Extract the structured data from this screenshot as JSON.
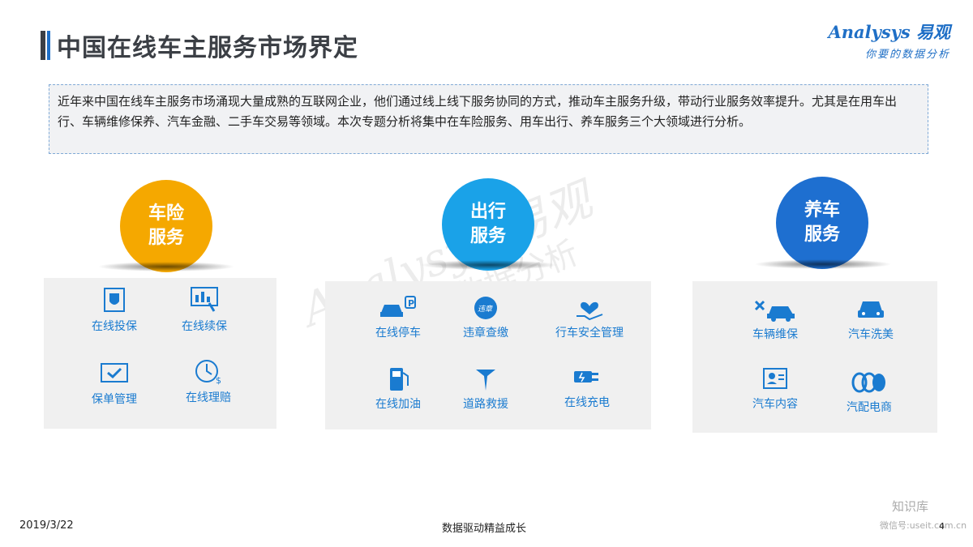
{
  "header": {
    "title": "中国在线车主服务市场界定",
    "logo_brand": "Analysys 易观",
    "logo_slogan": "你要的数据分析"
  },
  "intro": "近年来中国在线车主服务市场涌现大量成熟的互联网企业，他们通过线上线下服务协同的方式，推动车主服务升级，带动行业服务效率提升。尤其是在用车出行、车辆维修保养、汽车金融、二手车交易等领域。本次专题分析将集中在车险服务、用车出行、养车服务三个大领域进行分析。",
  "sections": [
    {
      "name_line1": "车险",
      "name_line2": "服务",
      "color": "#f5a800",
      "items": [
        "在线投保",
        "在线续保",
        "保单管理",
        "在线理赔"
      ]
    },
    {
      "name_line1": "出行",
      "name_line2": "服务",
      "color": "#1aa2e8",
      "items": [
        "在线停车",
        "违章查缴",
        "行车安全管理",
        "在线加油",
        "道路救援",
        "在线充电"
      ]
    },
    {
      "name_line1": "养车",
      "name_line2": "服务",
      "color": "#1e6fd0",
      "items": [
        "车辆维保",
        "汽车洗美",
        "汽车内容",
        "汽配电商"
      ]
    }
  ],
  "watermark": {
    "brand": "Analysys 易观",
    "slogan": "你要的数据分析"
  },
  "footer": {
    "date": "2019/3/22",
    "center": "数据驱动精益成长",
    "page": "4",
    "wechat_name": "知识库",
    "wechat_id": "微信号:useit.com.cn"
  },
  "colors": {
    "accent": "#1f6fc6",
    "icon": "#1a7bd0"
  }
}
